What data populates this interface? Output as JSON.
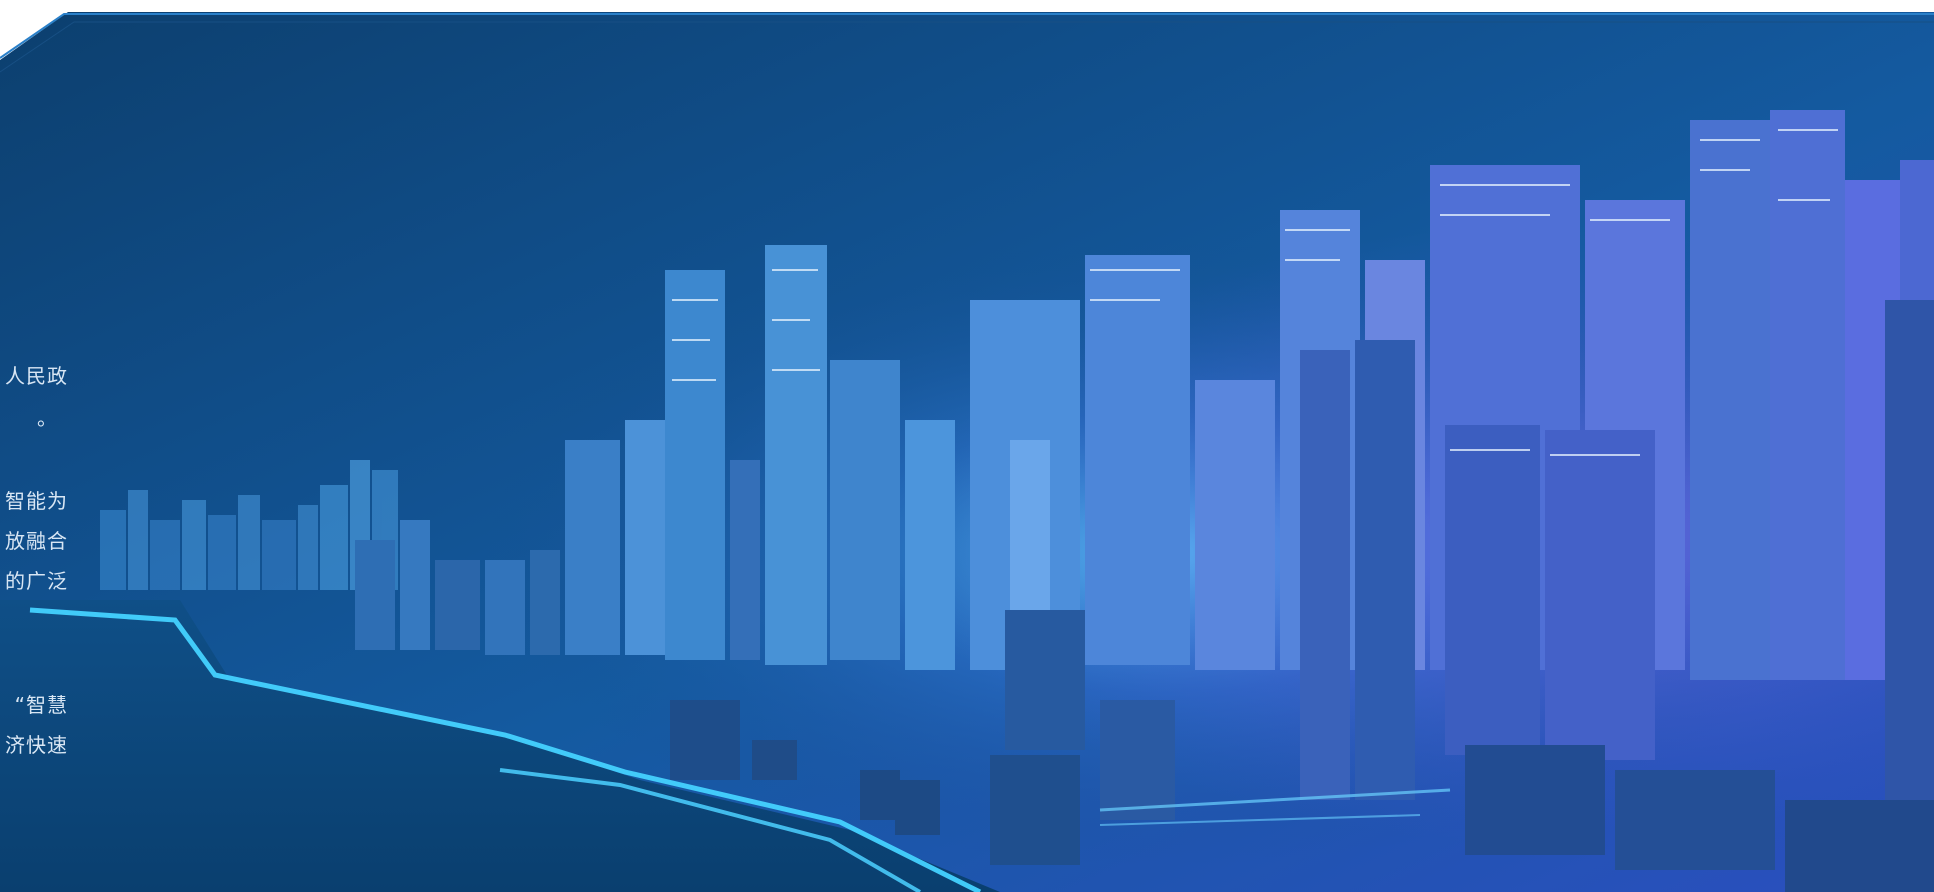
{
  "text_lines": [
    "人民政",
    "。",
    "智能为",
    "放融合",
    "的广泛",
    "“智慧",
    "济快速"
  ],
  "colors": {
    "background_top": "#0b3f6d",
    "background_mid": "#11548e",
    "frame_line": "#2a80c9",
    "glow_cyan": "#45d2ff",
    "glow_purple": "#9a7cff",
    "text": "#d8e6f4"
  }
}
